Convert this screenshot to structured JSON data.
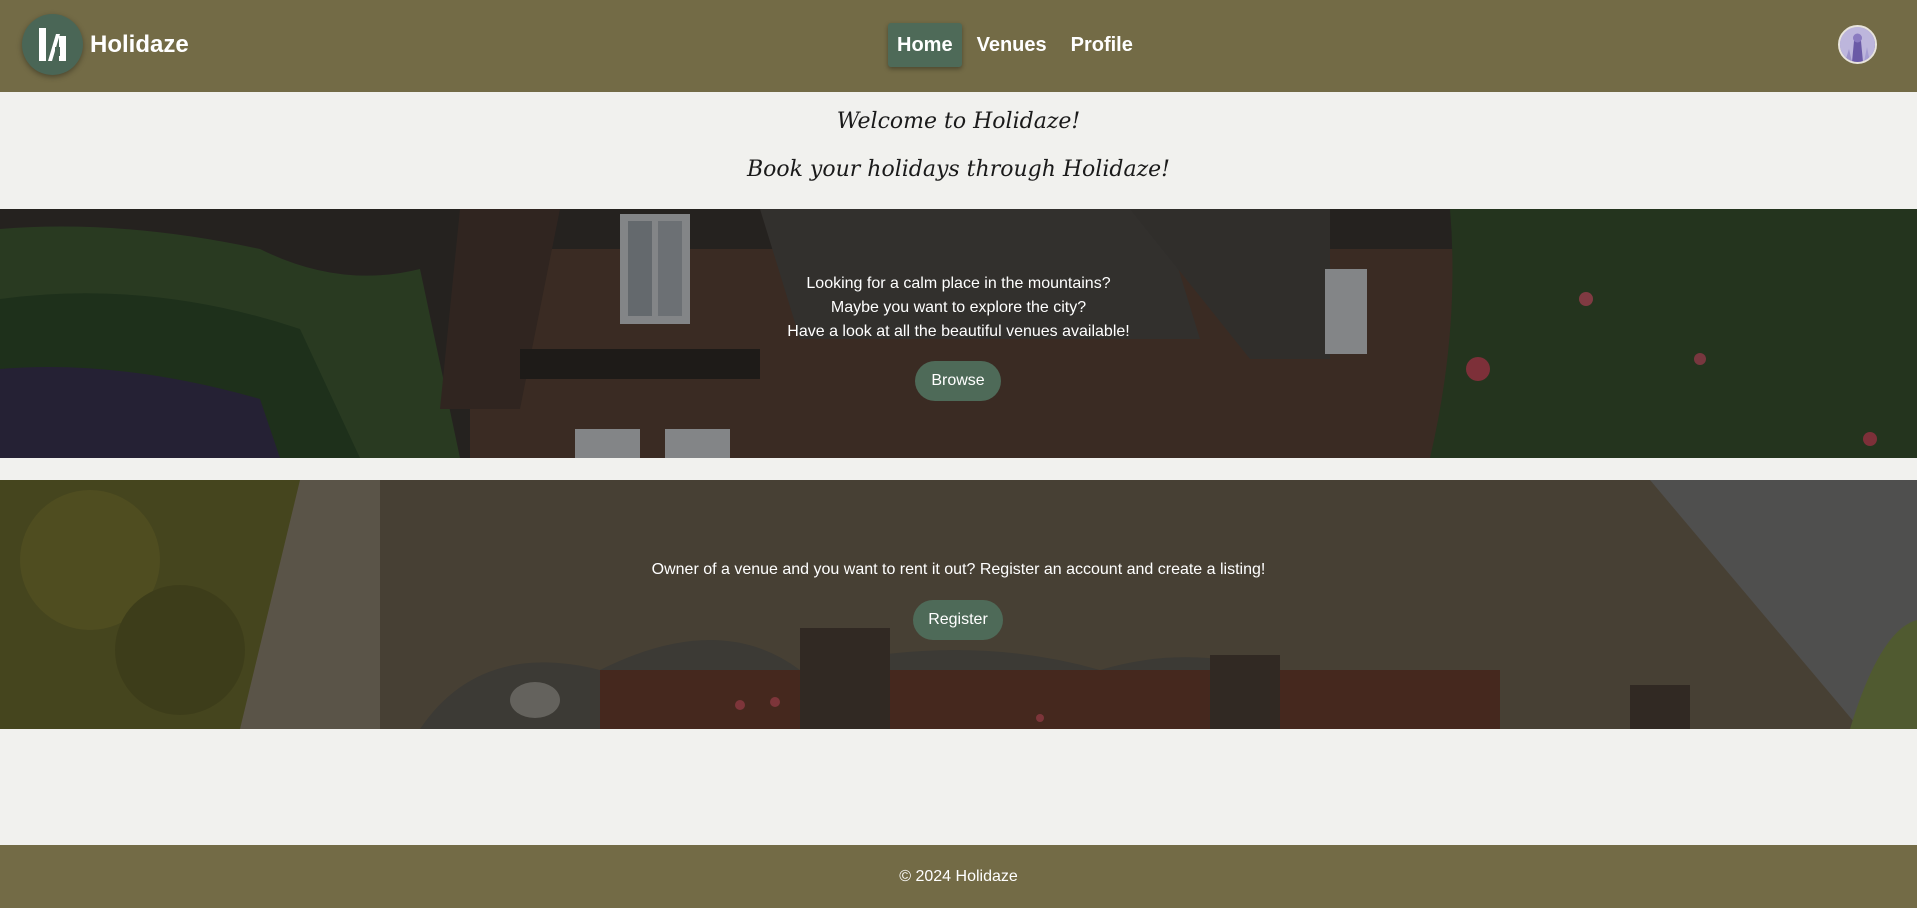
{
  "header": {
    "brand": "Holidaze",
    "logo_icon": "holidaze-logo-icon",
    "nav": [
      {
        "label": "Home",
        "active": true
      },
      {
        "label": "Venues",
        "active": false
      },
      {
        "label": "Profile",
        "active": false
      }
    ],
    "avatar_icon": "user-avatar"
  },
  "welcome": {
    "title": "Welcome to Holidaze!",
    "subtitle": "Book your holidays through Holidaze!"
  },
  "banners": [
    {
      "lines": [
        "Looking for a calm place in the mountains?",
        "Maybe you want to explore the city?",
        "Have a look at all the beautiful venues available!"
      ],
      "button": "Browse"
    },
    {
      "lines": [
        "Owner of a venue and you want to rent it out? Register an account and create a listing!"
      ],
      "button": "Register"
    }
  ],
  "footer": {
    "text": "© 2024 Holidaze"
  },
  "colors": {
    "header_bg": "#736b46",
    "accent_green": "#4e6a58",
    "page_bg": "#f1f1ee"
  }
}
